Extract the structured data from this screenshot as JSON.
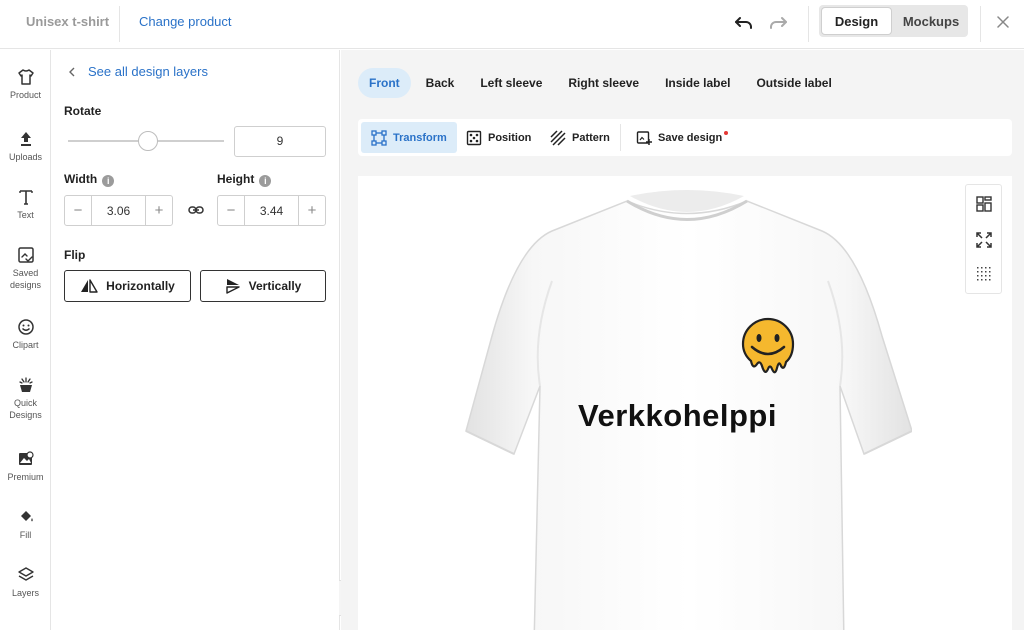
{
  "header": {
    "product_name": "Unisex t-shirt",
    "change_product": "Change product",
    "modes": {
      "design": "Design",
      "mockups": "Mockups"
    }
  },
  "rail": {
    "items": [
      {
        "label": "Product",
        "icon": "shirt-icon"
      },
      {
        "label": "Uploads",
        "icon": "upload-icon"
      },
      {
        "label": "Text",
        "icon": "text-icon"
      },
      {
        "label": "Saved designs",
        "icon": "saved-designs-icon"
      },
      {
        "label": "Clipart",
        "icon": "smiley-icon"
      },
      {
        "label": "Quick Designs",
        "icon": "quick-designs-icon"
      },
      {
        "label": "Premium",
        "icon": "premium-icon"
      },
      {
        "label": "Fill",
        "icon": "fill-bucket-icon"
      },
      {
        "label": "Layers",
        "icon": "layers-icon"
      }
    ]
  },
  "panel": {
    "back_link": "See all design layers",
    "rotate": {
      "label": "Rotate",
      "value": "9",
      "min": 0,
      "max": 360
    },
    "width": {
      "label": "Width",
      "value": "3.06"
    },
    "height": {
      "label": "Height",
      "value": "3.44"
    },
    "flip": {
      "label": "Flip",
      "horizontally": "Horizontally",
      "vertically": "Vertically"
    }
  },
  "placements": {
    "tabs": [
      "Front",
      "Back",
      "Left sleeve",
      "Right sleeve",
      "Inside label",
      "Outside label"
    ],
    "active": "Front"
  },
  "toolbar": {
    "transform": "Transform",
    "position": "Position",
    "pattern": "Pattern",
    "save_design": "Save design"
  },
  "canvas": {
    "design_text": "Verkkohelppi",
    "shirt_color": "#ffffff",
    "logo_color": "#f5b82e"
  },
  "colors": {
    "accent": "#2a72c8",
    "accent_bg": "#dcecf9",
    "unsaved_dot": "#e53935"
  }
}
